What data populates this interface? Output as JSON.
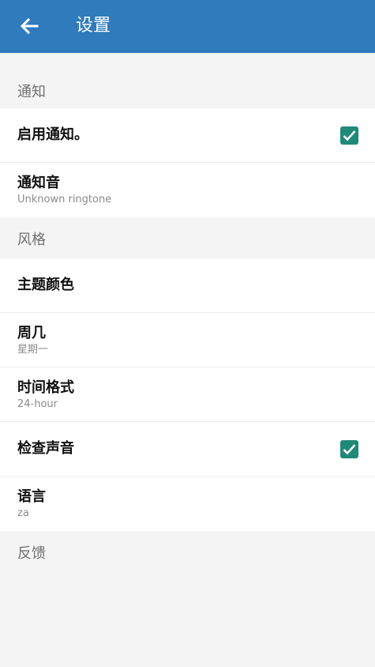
{
  "app_bar": {
    "title": "设置",
    "color": "#2f7bbd"
  },
  "sections": {
    "notifications": {
      "header": "通知",
      "enable_notifications": {
        "label": "启用通知。",
        "checked": true
      },
      "notification_sound": {
        "label": "通知音",
        "value": "Unknown ringtone"
      }
    },
    "style": {
      "header": "风格",
      "theme_color": {
        "label": "主题颜色"
      },
      "first_day": {
        "label": "周几",
        "value": "星期一"
      },
      "time_format": {
        "label": "时间格式",
        "value": "24-hour"
      },
      "check_sound": {
        "label": "检查声音",
        "checked": true
      },
      "language": {
        "label": "语言",
        "value": "za"
      }
    },
    "feedback": {
      "header": "反馈"
    }
  },
  "colors": {
    "checkbox": "#1f8a78",
    "background": "#f4f4f4"
  }
}
